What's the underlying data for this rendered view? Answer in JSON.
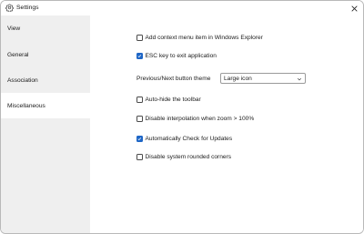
{
  "window": {
    "title": "Settings"
  },
  "sidebar": {
    "items": [
      {
        "label": "View"
      },
      {
        "label": "General"
      },
      {
        "label": "Association"
      },
      {
        "label": "Miscellaneous"
      }
    ]
  },
  "settings": {
    "context_menu": {
      "label": "Add context menu item in Windows Explorer",
      "checked": false
    },
    "esc_exit": {
      "label": "ESC key to exit application",
      "checked": true
    },
    "prev_next_theme": {
      "label": "Previous/Next button theme",
      "value": "Large icon"
    },
    "autohide_toolbar": {
      "label": "Auto-hide the toolbar",
      "checked": false
    },
    "disable_interpolation": {
      "label": "Disable interpolation when zoom > 100%",
      "checked": false
    },
    "auto_updates": {
      "label": "Automatically Check for Updates",
      "checked": true
    },
    "disable_rounded": {
      "label": "Disable system rounded corners",
      "checked": false
    }
  },
  "colors": {
    "accent": "#1e66c6",
    "sidebar_bg": "#efefef"
  }
}
